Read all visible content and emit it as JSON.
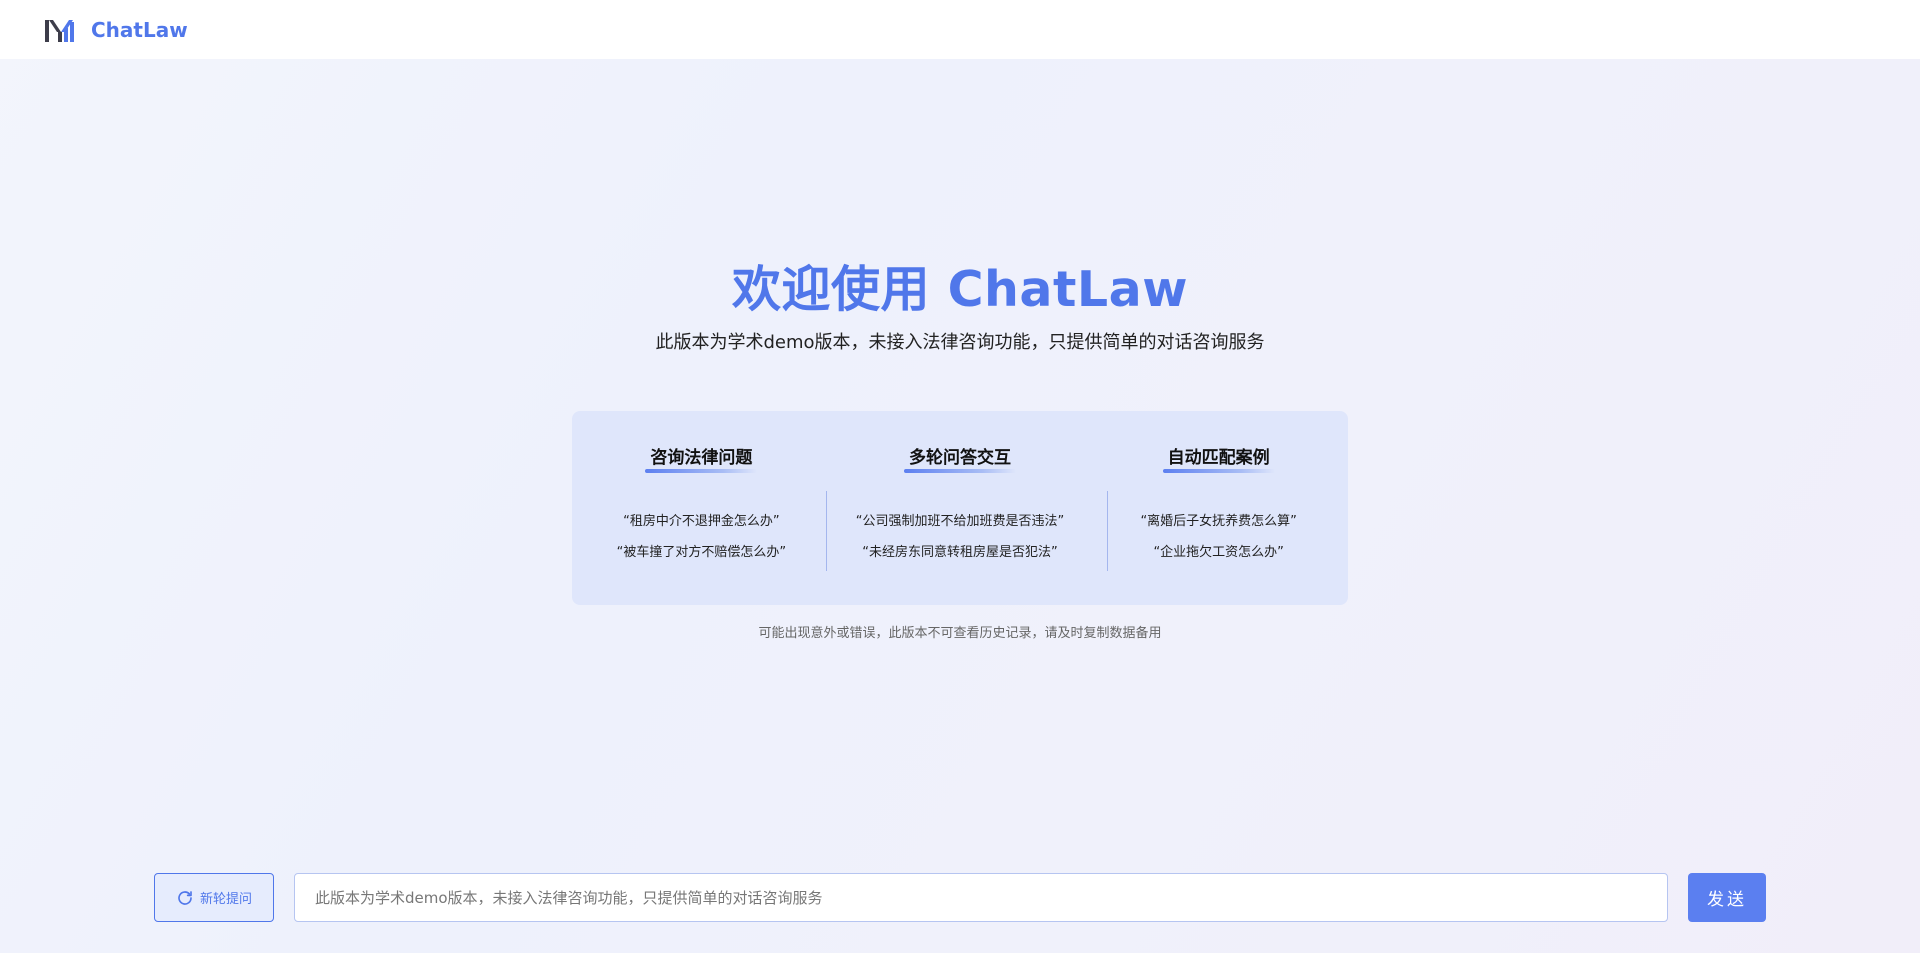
{
  "header": {
    "brand": "ChatLaw",
    "logo_icon": "chatlaw-logo"
  },
  "hero": {
    "title": "欢迎使用 ChatLaw",
    "subtitle": "此版本为学术demo版本，未接入法律咨询功能，只提供简单的对话咨询服务"
  },
  "features": [
    {
      "title": "咨询法律问题",
      "examples": [
        "“租房中介不退押金怎么办”",
        "“被车撞了对方不赔偿怎么办”"
      ]
    },
    {
      "title": "多轮问答交互",
      "examples": [
        "“公司强制加班不给加班费是否违法”",
        "“未经房东同意转租房屋是否犯法”"
      ]
    },
    {
      "title": "自动匹配案例",
      "examples": [
        "“离婚后子女抚养费怎么算”",
        "“企业拖欠工资怎么办”"
      ]
    }
  ],
  "note": "可能出现意外或错误，此版本不可查看历史记录，请及时复制数据备用",
  "composer": {
    "new_question_label": "新轮提问",
    "new_question_icon": "refresh-icon",
    "input_value": "",
    "input_placeholder": "此版本为学术demo版本，未接入法律咨询功能，只提供简单的对话咨询服务",
    "send_label": "发送"
  },
  "colors": {
    "accent": "#5077ea",
    "send_button": "#5b7ff0",
    "feature_panel": "#dfe6fb"
  }
}
